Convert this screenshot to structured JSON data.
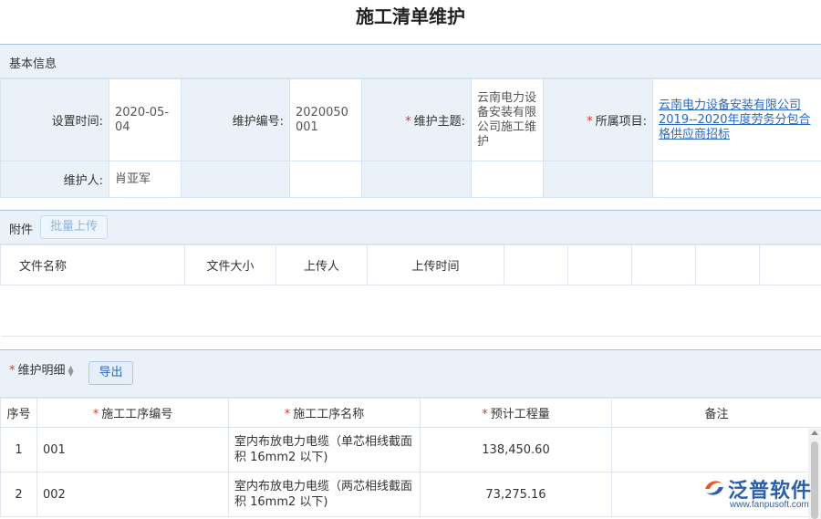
{
  "page": {
    "title": "施工清单维护"
  },
  "basic": {
    "section_label": "基本信息",
    "row1": [
      {
        "label": "设置时间:",
        "required": false,
        "value": "2020-05-04"
      },
      {
        "label": "维护编号:",
        "required": false,
        "value": "2020050001"
      },
      {
        "label": "维护主题:",
        "required": true,
        "value": "云南电力设备安装有限公司施工维护"
      },
      {
        "label": "所属项目:",
        "required": true,
        "value": "云南电力设备安装有限公司2019--2020年度劳务分包合格供应商招标"
      }
    ],
    "row2": [
      {
        "label": "维护人:",
        "value": "肖亚军"
      }
    ]
  },
  "attachments": {
    "section_label": "附件",
    "batch_upload_label": "批量上传",
    "columns": [
      "文件名称",
      "文件大小",
      "上传人",
      "上传时间"
    ]
  },
  "details": {
    "section_label": "维护明细",
    "export_label": "导出",
    "columns": {
      "index": "序号",
      "code": "施工工序编号",
      "name": "施工工序名称",
      "qty": "预计工程量",
      "note": "备注"
    },
    "rows": [
      {
        "index": "1",
        "code": "001",
        "name": "室内布放电力电缆（单芯相线截面积 16mm2 以下)",
        "qty": "138,450.60",
        "note": ""
      },
      {
        "index": "2",
        "code": "002",
        "name": "室内布放电力电缆（两芯相线截面积 16mm2 以下)",
        "qty": "73,275.16",
        "note": ""
      }
    ]
  },
  "watermark": {
    "brand": "泛普软件",
    "url": "www.fanpusoft.com",
    "color": "#2b5fa8"
  }
}
